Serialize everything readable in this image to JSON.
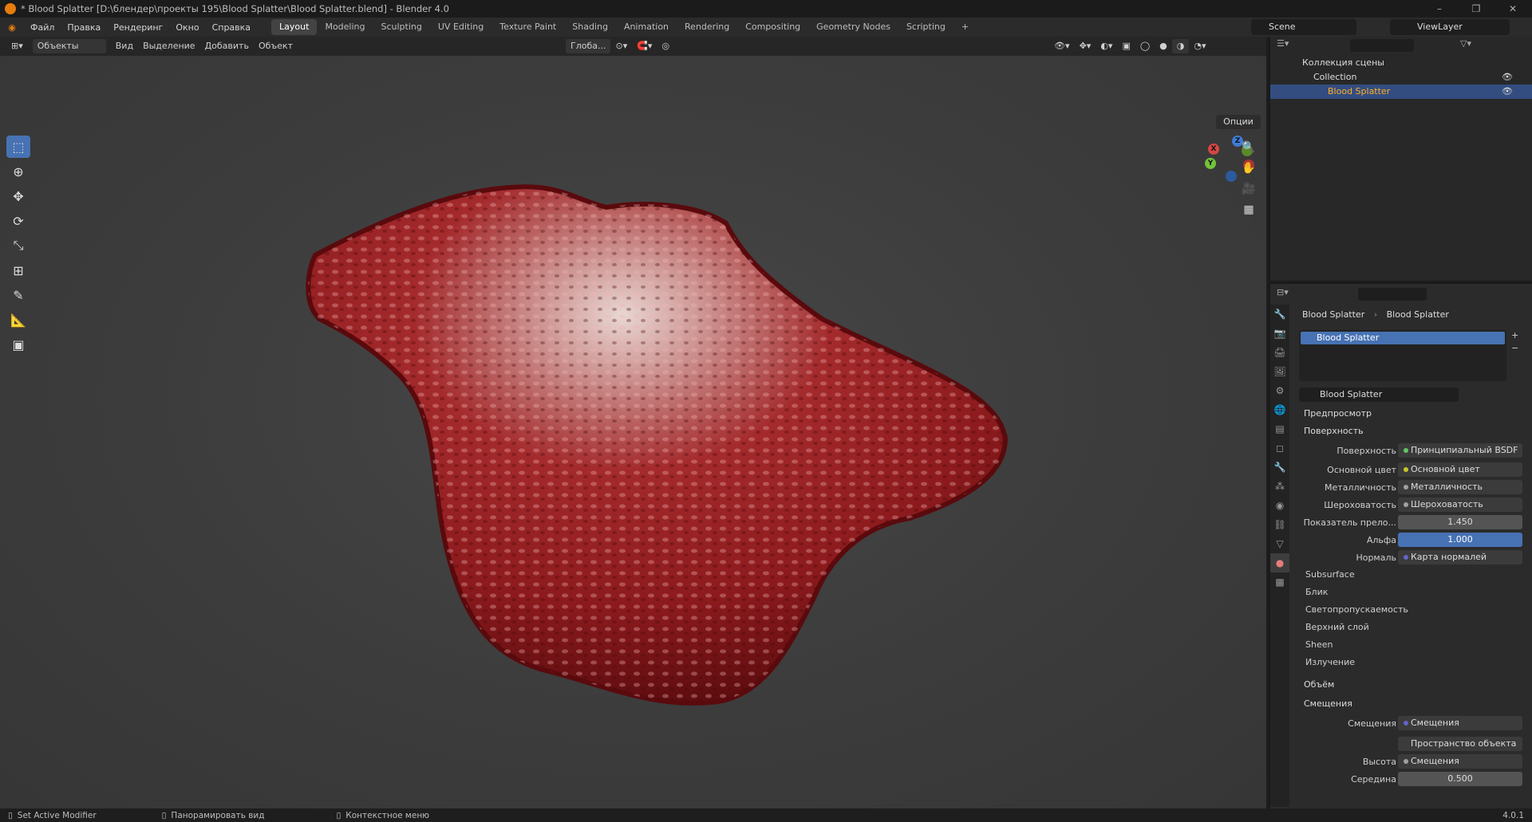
{
  "window": {
    "title": "* Blood Splatter [D:\\блендер\\проекты 195\\Blood Splatter\\Blood Splatter.blend] - Blender 4.0",
    "minimize": "–",
    "maximize": "❐",
    "close": "✕"
  },
  "menu": [
    "Файл",
    "Правка",
    "Рендеринг",
    "Окно",
    "Справка"
  ],
  "workspaces": [
    "Layout",
    "Modeling",
    "Sculpting",
    "UV Editing",
    "Texture Paint",
    "Shading",
    "Animation",
    "Rendering",
    "Compositing",
    "Geometry Nodes",
    "Scripting",
    "+"
  ],
  "active_workspace": "Layout",
  "scene": "Scene",
  "view_layer": "ViewLayer",
  "viewport_header": {
    "mode": "Объекты",
    "menus": [
      "Вид",
      "Выделение",
      "Добавить",
      "Объект"
    ],
    "transform": "Глоба...",
    "options": "Опции"
  },
  "gizmo": {
    "x": "X",
    "y": "Y",
    "z": "Z"
  },
  "outliner": {
    "root": "Коллекция сцены",
    "collection": "Collection",
    "object": "Blood Splatter"
  },
  "properties": {
    "breadcrumb": [
      "Blood Splatter",
      "Blood Splatter"
    ],
    "material_slot": "Blood Splatter",
    "material_name": "Blood Splatter",
    "sections": {
      "preview": "Предпросмотр",
      "surface": "Поверхность",
      "volume": "Объём",
      "displacement": "Смещения"
    },
    "surface_rows": [
      {
        "label": "Поверхность",
        "value": "Принципиальный BSDF",
        "dot": "#63c763"
      },
      {
        "label": "Основной цвет",
        "value": "Основной цвет",
        "dot": "#c7c729"
      },
      {
        "label": "Металличность",
        "value": "Металличность",
        "dot": "#a1a1a1"
      },
      {
        "label": "Шероховатость",
        "value": "Шероховатость",
        "dot": "#a1a1a1"
      },
      {
        "label": "Показатель прело...",
        "value": "1.450",
        "dot": "#a1a1a1"
      },
      {
        "label": "Альфа",
        "value": "1.000",
        "dot": "#a1a1a1"
      },
      {
        "label": "Нормаль",
        "value": "Карта нормалей",
        "dot": "#6363c7"
      }
    ],
    "subsections": [
      "Subsurface",
      "Блик",
      "Светопропускаемость",
      "Верхний слой",
      "Sheen",
      "Излучение"
    ],
    "displacement_rows": [
      {
        "label": "Смещения",
        "value": "Смещения",
        "dot": "#6363c7"
      },
      {
        "label": "",
        "value": "Пространство объекта",
        "dot": ""
      },
      {
        "label": "Высота",
        "value": "Смещения",
        "dot": "#a1a1a1"
      },
      {
        "label": "Середина",
        "value": "0.500",
        "dot": "#a1a1a1"
      }
    ]
  },
  "status": {
    "left": "Set Active Modifier",
    "middle": "Панорамировать вид",
    "right": "Контекстное меню",
    "version": "4.0.1"
  }
}
